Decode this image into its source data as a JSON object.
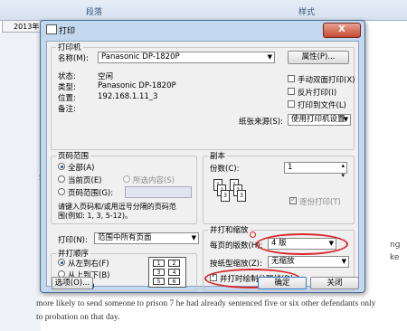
{
  "background": {
    "ribbon_left": "段落",
    "ribbon_right": "样式",
    "doc_tab": "2013年",
    "text_lines": [
      "more likely to send someone to prison 7 he had already sentenced five or six other defendants only",
      "to probation on that day."
    ],
    "side_chars": [
      "2",
      "S",
      "1",
      "2",
      "ng",
      "ke"
    ]
  },
  "dialog": {
    "title": "打印",
    "close": "X",
    "printer": {
      "group": "打印机",
      "name_label": "名称(M):",
      "name_value": "Panasonic DP-1820P",
      "properties": "属性(P)...",
      "status_label": "状态:",
      "status_value": "空闲",
      "type_label": "类型:",
      "type_value": "Panasonic DP-1820P",
      "where_label": "位置:",
      "where_value": "192.168.1.11_3",
      "comment_label": "备注:",
      "manual_duplex": "手动双面打印(X)",
      "reverse": "反片打印(I)",
      "to_file": "打印到文件(L)",
      "paper_source_label": "纸张来源(S):",
      "paper_source_value": "使用打印机设置"
    },
    "range": {
      "group": "页码范围",
      "all": "全部(A)",
      "current": "当前页(E)",
      "selection": "所选内容(S)",
      "pages": "页码范围(G):",
      "hint1": "请键入页码和/或用逗号分隔的页码范",
      "hint2": "围(例如: 1, 3, 5-12)。"
    },
    "copies": {
      "group": "副本",
      "count_label": "份数(C):",
      "count_value": "1",
      "collate": "逐份打印(T)"
    },
    "print_what_label": "打印(N):",
    "print_what_value": "范围中所有页面",
    "order": {
      "group": "并打顺序",
      "ltr": "从左到右(F)",
      "ttb": "从上到下(B)",
      "repeat": "重复(R)"
    },
    "zoom": {
      "group": "并打和缩放",
      "pages_label": "每页的版数(H):",
      "pages_value": "4 版",
      "scale_label": "按纸型缩放(Z):",
      "scale_value": "无缩放",
      "draw_borders": "并打时绘制分隔线(D)"
    },
    "options_btn": "选项(O)...",
    "ok_btn": "确定",
    "cancel_btn": "关闭",
    "layout_pages": [
      "1",
      "2",
      "3",
      "4",
      "5",
      "6"
    ]
  }
}
